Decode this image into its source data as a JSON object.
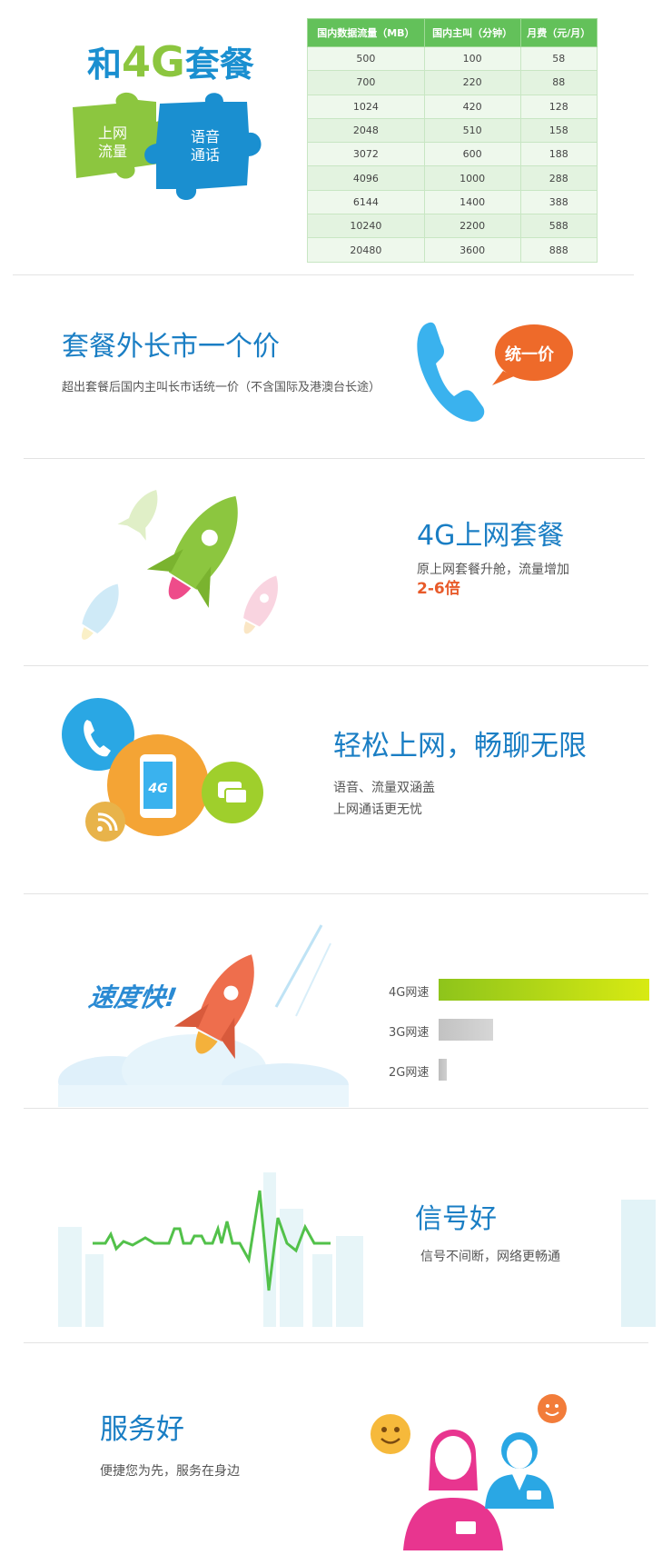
{
  "section1": {
    "brand_pre": "和",
    "brand_4g": "4G",
    "brand_post": "套餐",
    "puzzle_left": [
      "上网",
      "流量"
    ],
    "puzzle_right": [
      "语音",
      "通话"
    ],
    "colors": {
      "green": "#8cc63f",
      "blue": "#1a8fd0"
    },
    "table": {
      "headers": [
        "国内数据流量（MB）",
        "国内主叫（分钟）",
        "月费（元/月）"
      ],
      "rows": [
        [
          "500",
          "100",
          "58"
        ],
        [
          "700",
          "220",
          "88"
        ],
        [
          "1024",
          "420",
          "128"
        ],
        [
          "2048",
          "510",
          "158"
        ],
        [
          "3072",
          "600",
          "188"
        ],
        [
          "4096",
          "1000",
          "288"
        ],
        [
          "6144",
          "1400",
          "388"
        ],
        [
          "10240",
          "2200",
          "588"
        ],
        [
          "20480",
          "3600",
          "888"
        ]
      ]
    }
  },
  "section2": {
    "title": "套餐外长市一个价",
    "subtitle": "超出套餐后国内主叫长市话统一价（不含国际及港澳台长途）",
    "bubble": "统一价",
    "icon": "phone-icon"
  },
  "section3": {
    "title": "4G上网套餐",
    "subtitle": "原上网套餐升舱，流量增加",
    "highlight": "2-6倍",
    "icon": "rocket-icon"
  },
  "section4": {
    "title": "轻松上网，畅聊无限",
    "line1": "语音、流量双涵盖",
    "line2": "上网通话更无忧",
    "phone_label": "4G"
  },
  "section5": {
    "slogan": "速度快!",
    "bars": [
      {
        "label": "4G网速",
        "value": 1.0
      },
      {
        "label": "3G网速",
        "value": 0.26
      },
      {
        "label": "2G网速",
        "value": 0.04
      }
    ]
  },
  "section6": {
    "title": "信号好",
    "subtitle": "信号不间断，网络更畅通"
  },
  "section7": {
    "title": "服务好",
    "subtitle": "便捷您为先，服务在身边"
  }
}
